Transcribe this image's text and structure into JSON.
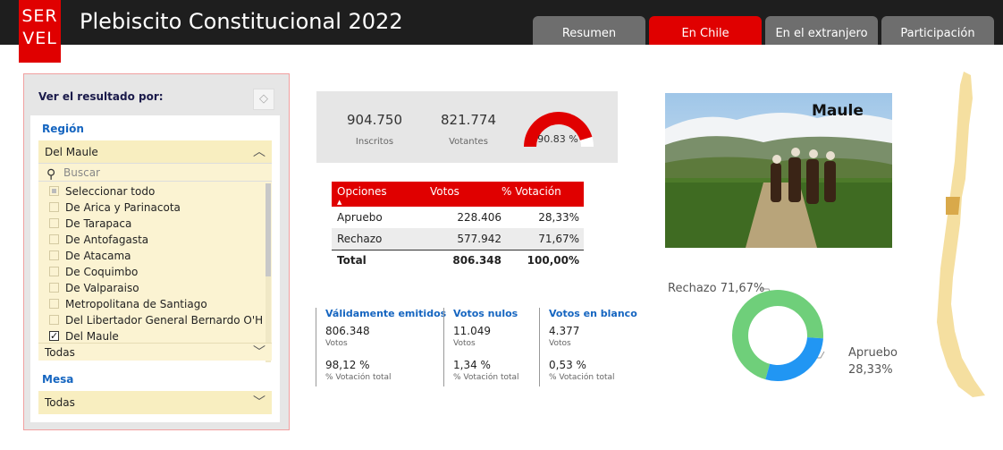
{
  "app": {
    "logo_line1": "SER",
    "logo_line2": "VEL",
    "title": "Plebiscito Constitucional 2022",
    "brand_color": "#e00000"
  },
  "tabs": [
    {
      "label": "Resumen",
      "active": false
    },
    {
      "label": "En Chile",
      "active": true
    },
    {
      "label": "En el extranjero",
      "active": false
    },
    {
      "label": "Participación",
      "active": false
    }
  ],
  "filter": {
    "title": "Ver el resultado por:",
    "eraser_icon": "eraser-icon",
    "region_label": "Región",
    "region_selected": "Del Maule",
    "search_placeholder": "Buscar",
    "items": [
      {
        "label": "Seleccionar todo",
        "state": "partial"
      },
      {
        "label": "De Arica y Parinacota",
        "state": "unchecked"
      },
      {
        "label": "De Tarapaca",
        "state": "unchecked"
      },
      {
        "label": "De Antofagasta",
        "state": "unchecked"
      },
      {
        "label": "De Atacama",
        "state": "unchecked"
      },
      {
        "label": "De Coquimbo",
        "state": "unchecked"
      },
      {
        "label": "De Valparaiso",
        "state": "unchecked"
      },
      {
        "label": "Metropolitana de Santiago",
        "state": "unchecked"
      },
      {
        "label": "Del Libertador General Bernardo O'Higgins",
        "state": "unchecked"
      },
      {
        "label": "Del Maule",
        "state": "checked"
      }
    ],
    "comuna_selected": "Todas",
    "mesa_label": "Mesa",
    "mesa_selected": "Todas"
  },
  "kpi": {
    "inscritos_value": "904.750",
    "inscritos_label": "Inscritos",
    "votantes_value": "821.774",
    "votantes_label": "Votantes",
    "participation_text": "90.83 %",
    "participation_fraction": 0.9083
  },
  "results": {
    "headers": [
      "Opciones",
      "Votos",
      "% Votación"
    ],
    "rows": [
      {
        "option": "Apruebo",
        "votes": "228.406",
        "pct": "28,33%"
      },
      {
        "option": "Rechazo",
        "votes": "577.942",
        "pct": "71,67%"
      }
    ],
    "total": {
      "option": "Total",
      "votes": "806.348",
      "pct": "100,00%"
    }
  },
  "stats": [
    {
      "title": "Válidamente emitidos",
      "value": "806.348",
      "value_label": "Votos",
      "pct": "98,12 %",
      "pct_label": "% Votación total"
    },
    {
      "title": "Votos nulos",
      "value": "11.049",
      "value_label": "Votos",
      "pct": "1,34 %",
      "pct_label": "% Votación total"
    },
    {
      "title": "Votos en blanco",
      "value": "4.377",
      "value_label": "Votos",
      "pct": "0,53 %",
      "pct_label": "% Votación total"
    }
  ],
  "photo": {
    "label": "Maule"
  },
  "donut": {
    "rechazo_label": "Rechazo 71,67%",
    "apruebo_label": "Apruebo",
    "apruebo_pct": "28,33%",
    "rechazo_value": 71.67,
    "apruebo_value": 28.33,
    "rechazo_color": "#6fcf7a",
    "apruebo_color": "#2196f3"
  },
  "map": {
    "highlight_region": "Del Maule",
    "map_color": "#f5dfa0",
    "highlight_color": "#d9a94a"
  }
}
